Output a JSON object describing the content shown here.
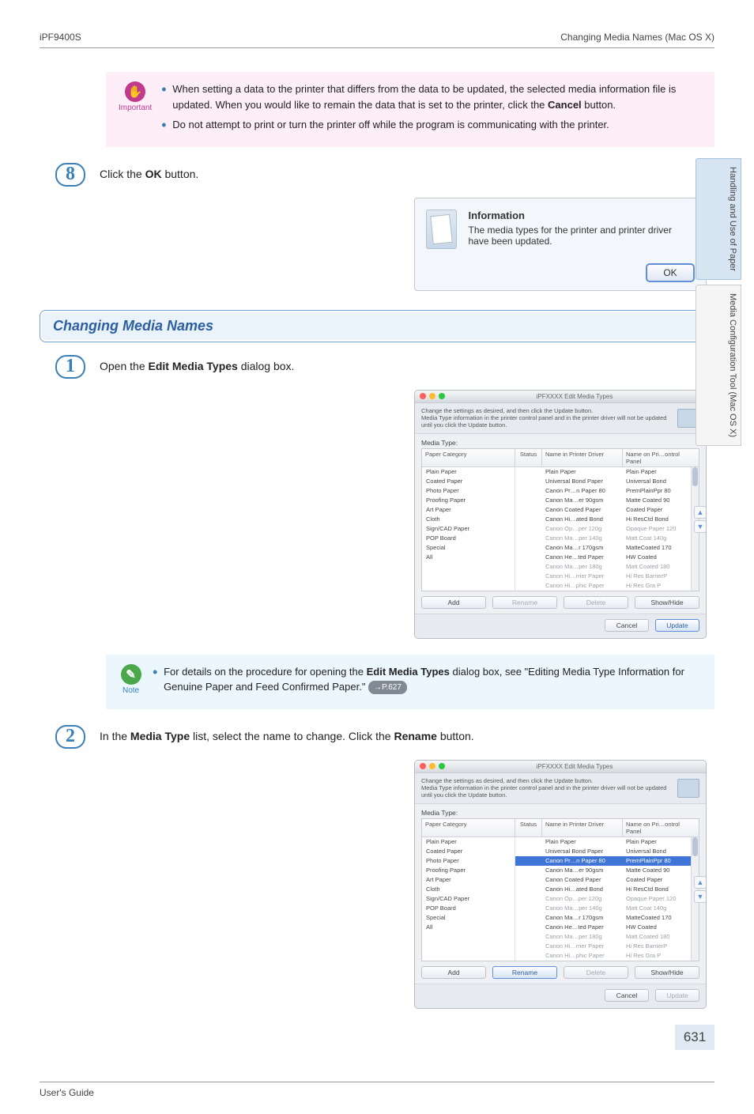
{
  "header": {
    "left": "iPF9400S",
    "right": "Changing Media Names (Mac OS X)"
  },
  "sidebar": {
    "tab1": "Handling and Use of Paper",
    "tab2": "Media Configuration Tool (Mac OS X)"
  },
  "important": {
    "label": "Important",
    "items": [
      "When setting a data to the printer that differs from the data to be updated, the selected media information file is updated. When you would like to remain the data that is set to the printer, click the <b>Cancel</b> button.",
      "Do not attempt to print or turn the printer off while the program is communicating with the printer."
    ]
  },
  "step8": {
    "num": "8",
    "text": "Click the <b>OK</b> button."
  },
  "info_dialog": {
    "title": "Information",
    "body": "The media types for the printer and printer driver have been updated.",
    "ok": "OK"
  },
  "section_title": "Changing Media Names",
  "step1": {
    "num": "1",
    "text": "Open the <b>Edit Media Types</b> dialog box."
  },
  "note": {
    "label": "Note",
    "text_before": "For details on the procedure for opening the <b>Edit Media Types</b> dialog box, see \"Editing Media Type Information for Genuine Paper and Feed Confirmed Paper.\"",
    "ref": "→P.627"
  },
  "step2": {
    "num": "2",
    "text": "In the <b>Media Type</b> list, select the name to change. Click the <b>Rename</b> button."
  },
  "mac_dialog": {
    "title": "iPFXXXX Edit Media Types",
    "subhead": "Change the settings as desired, and then click the Update button.\nMedia Type information in the printer control panel and in the printer driver will not be updated until you click the Update button.",
    "label": "Media Type:",
    "head": {
      "cat": "Paper Category",
      "stat": "Status",
      "drv": "Name in Printer Driver",
      "pnl": "Name on Pri…ontrol Panel"
    },
    "cats": [
      "Plain Paper",
      "Coated Paper",
      "Photo Paper",
      "Proofing Paper",
      "Art Paper",
      "Cloth",
      "Sign/CAD Paper",
      "POP Board",
      "Special",
      "All"
    ],
    "rows": [
      {
        "drv": "Plain Paper",
        "pnl": "Plain Paper",
        "g": 0
      },
      {
        "drv": "Universal Bond Paper",
        "pnl": "Universal Bond",
        "g": 0
      },
      {
        "drv": "Canon Pr…n Paper 80",
        "pnl": "PremPlainPpr 80",
        "g": 0
      },
      {
        "drv": "Canon Ma…er 90gsm",
        "pnl": "Matte Coated 90",
        "g": 0
      },
      {
        "drv": "Canon Coated Paper",
        "pnl": "Coated Paper",
        "g": 0
      },
      {
        "drv": "Canon Hi…ated Bond",
        "pnl": "Hi ResCtd Bond",
        "g": 0
      },
      {
        "drv": "Canon Op…per 120g",
        "pnl": "Opaque Paper 120",
        "g": 1
      },
      {
        "drv": "Canon Ma…per 140g",
        "pnl": "Matt Coat 140g",
        "g": 1
      },
      {
        "drv": "Canon Ma…r 170gsm",
        "pnl": "MatteCoated 170",
        "g": 0
      },
      {
        "drv": "Canon He…ted Paper",
        "pnl": "HW Coated",
        "g": 0
      },
      {
        "drv": "Canon Ma…per 180g",
        "pnl": "Matt Coated 180",
        "g": 1
      },
      {
        "drv": "Canon Hi…rrier Paper",
        "pnl": "Hi Res BarrierP",
        "g": 1
      },
      {
        "drv": "Canon Hi…phic Paper",
        "pnl": "Hi Res Gra P",
        "g": 1
      }
    ],
    "btns": {
      "add": "Add",
      "rename": "Rename",
      "delete": "Delete",
      "show": "Show/Hide",
      "cancel": "Cancel",
      "update": "Update"
    }
  },
  "page_number": "631",
  "footer": {
    "left": "User's Guide",
    "right": ""
  }
}
